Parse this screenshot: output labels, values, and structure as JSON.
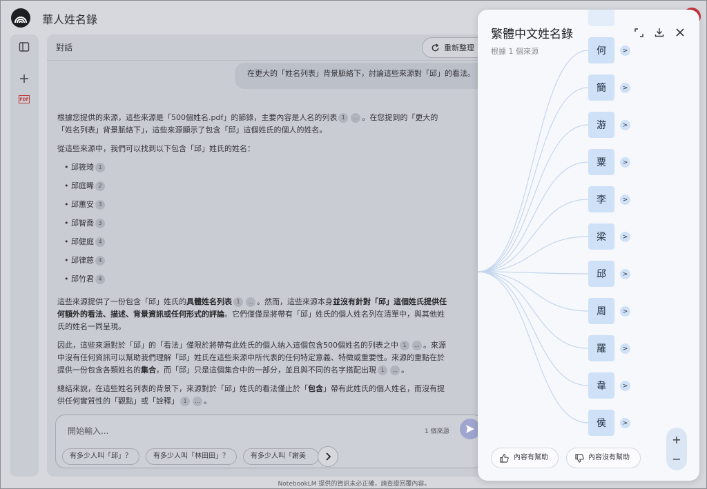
{
  "app": {
    "title": "華人姓名錄"
  },
  "chat": {
    "header_title": "對話",
    "refresh_label": "重新整理",
    "user_message": "在更大的「姓名列表」背景脈絡下，討論這些來源對「邱」的看法。",
    "answer": {
      "p1a": "根據您提供的來源，這些來源是「500個姓名.pdf」的節錄，主要內容是人名的列表",
      "p1b": "。在您提到的「更大的「姓名列表」背景脈絡下」，這些來源顯示了包含「邱」這個姓氏的個人的姓名。",
      "p2": "從這些來源中，我們可以找到以下包含「邱」姓氏的姓名：",
      "names": [
        {
          "name": "• 邱筱琦",
          "cite": "1"
        },
        {
          "name": "• 邱庭晞",
          "cite": "2"
        },
        {
          "name": "• 邱蕙安",
          "cite": "3"
        },
        {
          "name": "• 邱智喬",
          "cite": "3"
        },
        {
          "name": "• 邱健庭",
          "cite": "4"
        },
        {
          "name": "• 邱律慈",
          "cite": "4"
        },
        {
          "name": "• 邱竹君",
          "cite": "4"
        }
      ],
      "p3a": "這些來源提供了一份包含「邱」姓氏的",
      "p3b": "具體姓名列表",
      "p3c": "。然而，這些來源本身",
      "p3d": "並沒有針對「邱」這個姓氏提供任何額外的看法、描述、背景資訊或任何形式的評論",
      "p3e": "。它們僅僅是將帶有「邱」姓氏的個人姓名列在清單中，與其他姓氏的姓名一同呈現。",
      "p4a": "因此，這些來源對於「邱」的「看法」僅限於將帶有此姓氏的個人納入這個包含500個姓名的列表之中",
      "p4b": "。來源中沒有任何資訊可以幫助我們理解「邱」姓氏在這些來源中所代表的任何特定意義、特徵或重要性。來源的重點在於提供一份包含各類姓名的",
      "p4c": "集合",
      "p4d": "，而「邱」只是這個集合中的一部分，並且與不同的名字搭配出現",
      "p5a": "總結來說，在這些姓名列表的背景下，來源對於「邱」姓氏的看法僅止於「",
      "p5b": "包含",
      "p5c": "」帶有此姓氏的個人姓名，而沒有提供任何實質性的「觀點」或「詮釋」",
      "cite_one": "1",
      "cite_more": "..."
    },
    "input_placeholder": "開始輸入...",
    "source_count": "1 個來源",
    "chips": [
      "有多少人叫「邱」？",
      "有多少人叫「林田田」？",
      "有多少人叫「謝美"
    ],
    "footer_note": "NotebookLM 提供的資訊未必正確，請查證回覆內容。"
  },
  "mindmap": {
    "title": "繁體中文姓名錄",
    "subtitle": "根據 1 個來源",
    "expand_glyph": ">",
    "nodes": [
      "何",
      "簡",
      "游",
      "粟",
      "李",
      "梁",
      "邱",
      "周",
      "羅",
      "韋",
      "侯"
    ],
    "feedback_good": "內容有幫助",
    "feedback_bad": "內容沒有幫助",
    "zoom_in": "+",
    "zoom_out": "−"
  },
  "icons": {
    "logo": "notebooklm-logo-icon",
    "sidebar_toggle": "sidebar-panel-icon",
    "add": "plus-icon",
    "pdf": "pdf-file-icon",
    "refresh": "refresh-icon",
    "send": "send-icon",
    "next": "chevron-right-icon",
    "fullscreen": "fullscreen-icon",
    "download": "download-icon",
    "close": "close-icon",
    "thumbs_up": "thumbs-up-icon",
    "thumbs_down": "thumbs-down-icon"
  },
  "colors": {
    "accent": "#9ea5cf",
    "node": "#cfe1f7",
    "pdf": "#c23a3a"
  }
}
